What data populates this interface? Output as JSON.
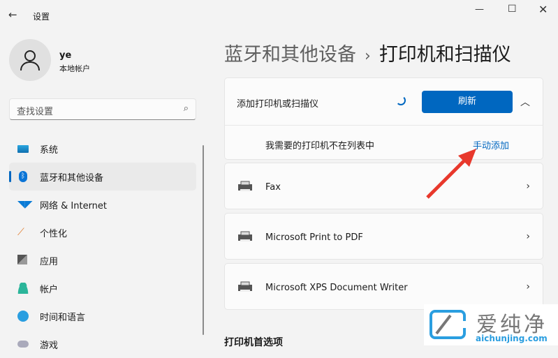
{
  "window": {
    "title": "设置",
    "back_icon": "back-arrow-icon"
  },
  "user": {
    "name": "ye",
    "account_type": "本地帐户"
  },
  "search": {
    "placeholder": "查找设置"
  },
  "sidebar": {
    "items": [
      {
        "label": "系统",
        "icon": "system-icon"
      },
      {
        "label": "蓝牙和其他设备",
        "icon": "bluetooth-icon",
        "selected": true
      },
      {
        "label": "网络 & Internet",
        "icon": "wifi-icon"
      },
      {
        "label": "个性化",
        "icon": "brush-icon"
      },
      {
        "label": "应用",
        "icon": "apps-icon"
      },
      {
        "label": "帐户",
        "icon": "account-icon"
      },
      {
        "label": "时间和语言",
        "icon": "time-language-icon"
      },
      {
        "label": "游戏",
        "icon": "game-icon"
      }
    ]
  },
  "breadcrumb": {
    "parent": "蓝牙和其他设备",
    "separator": "›",
    "current": "打印机和扫描仪"
  },
  "add_card": {
    "label": "添加打印机或扫描仪",
    "refresh": "刷新",
    "sub_label": "我需要的打印机不在列表中",
    "manual_add": "手动添加"
  },
  "printers": [
    {
      "name": "Fax"
    },
    {
      "name": "Microsoft Print to PDF"
    },
    {
      "name": "Microsoft XPS Document Writer"
    }
  ],
  "section_title": "打印机首选项",
  "watermark": {
    "text": "爱纯净",
    "url": "aichunjing.com"
  },
  "colors": {
    "accent": "#0067c0",
    "annotation": "#e8382c"
  }
}
